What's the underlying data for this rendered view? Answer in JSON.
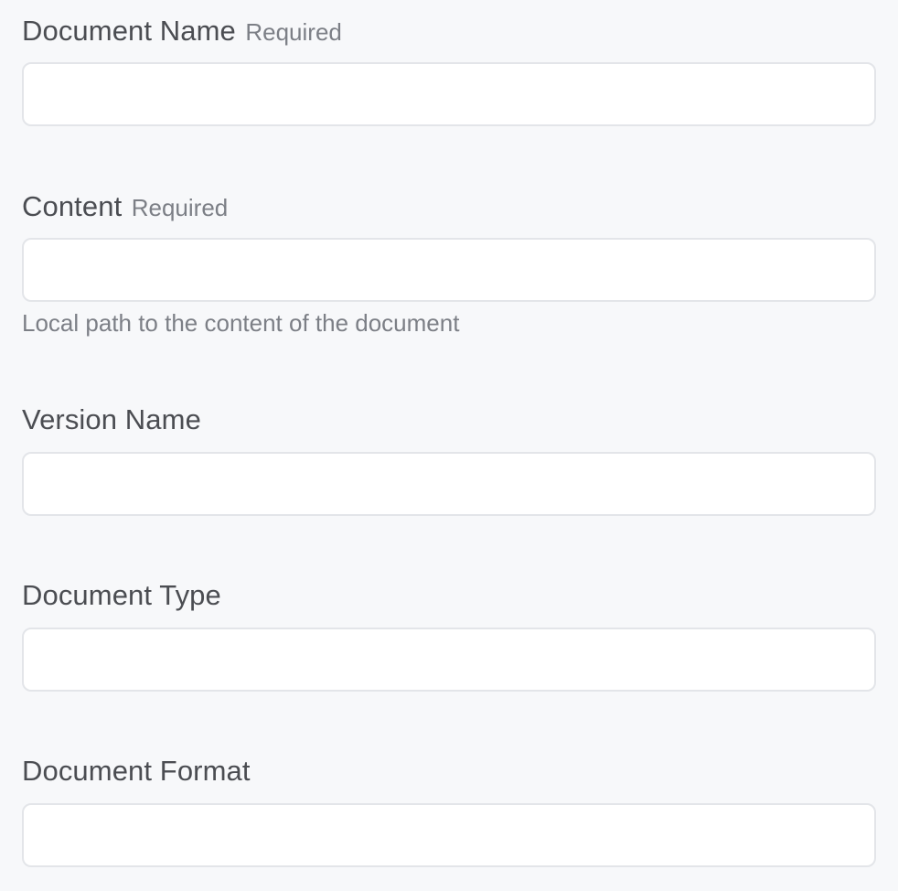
{
  "form": {
    "fields": [
      {
        "label": "Document Name",
        "required": "Required",
        "value": "",
        "placeholder": ""
      },
      {
        "label": "Content",
        "required": "Required",
        "value": "",
        "placeholder": "",
        "help": "Local path to the content of the document"
      },
      {
        "label": "Version Name",
        "value": "",
        "placeholder": ""
      },
      {
        "label": "Document Type",
        "value": "",
        "placeholder": ""
      },
      {
        "label": "Document Format",
        "value": "",
        "placeholder": ""
      }
    ]
  }
}
